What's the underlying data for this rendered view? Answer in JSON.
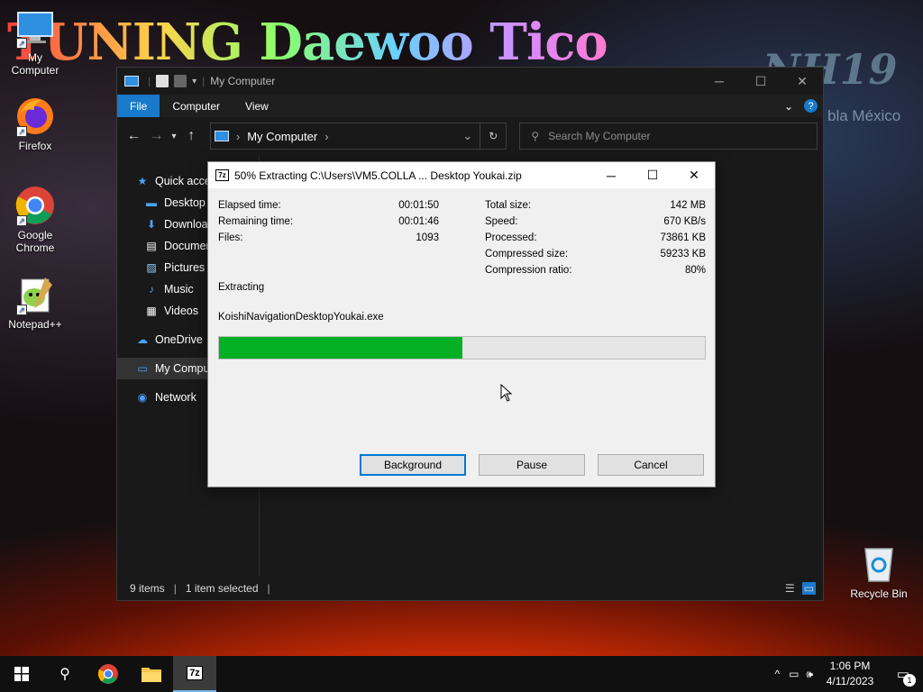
{
  "wallpaper": {
    "title": "TUNING Daewoo Tico",
    "right_line_1": "NH19",
    "right_line_2": "bla México"
  },
  "desktop_icons": [
    {
      "label": "My Computer"
    },
    {
      "label": "Firefox"
    },
    {
      "label": "Google Chrome"
    },
    {
      "label": "Notepad++"
    },
    {
      "label": "Recycle Bin"
    }
  ],
  "explorer": {
    "title": "My Computer",
    "ribbon_tabs": [
      "File",
      "Computer",
      "View"
    ],
    "address": "My Computer",
    "search_placeholder": "Search My Computer",
    "nav_items": [
      "Quick access",
      "Desktop",
      "Downloads",
      "Documents",
      "Pictures",
      "Music",
      "Videos",
      "OneDrive",
      "My Computer",
      "Network"
    ],
    "status": {
      "items": "9 items",
      "selected": "1 item selected"
    }
  },
  "dialog": {
    "title": "50% Extracting C:\\Users\\VM5.COLLA ... Desktop Youkai.zip",
    "left_stats": [
      {
        "label": "Elapsed time:",
        "value": "00:01:50"
      },
      {
        "label": "Remaining time:",
        "value": "00:01:46"
      },
      {
        "label": "Files:",
        "value": "1093"
      }
    ],
    "right_stats": [
      {
        "label": "Total size:",
        "value": "142 MB"
      },
      {
        "label": "Speed:",
        "value": "670 KB/s"
      },
      {
        "label": "Processed:",
        "value": "73861 KB"
      },
      {
        "label": "Compressed size:",
        "value": "59233 KB"
      },
      {
        "label": "Compression ratio:",
        "value": "80%"
      }
    ],
    "operation": "Extracting",
    "current_file": "KoishiNavigationDesktopYoukai.exe",
    "progress": 0.5,
    "buttons": {
      "background": "Background",
      "pause": "Pause",
      "cancel": "Cancel"
    }
  },
  "taskbar": {
    "clock_time": "1:06 PM",
    "clock_date": "4/11/2023",
    "notification_count": "1"
  },
  "colors": {
    "accent": "#1979ca",
    "progress": "#06b025"
  }
}
